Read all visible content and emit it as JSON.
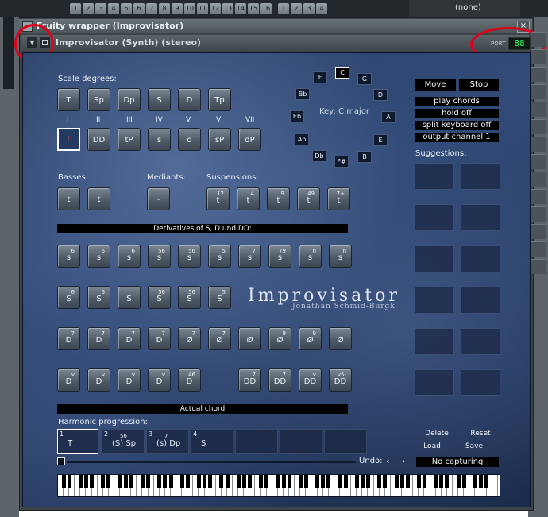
{
  "top_strip": {
    "steps": [
      "1",
      "2",
      "3",
      "4",
      "5",
      "6",
      "7",
      "8",
      "9",
      "10",
      "11",
      "12",
      "13",
      "14",
      "15",
      "16",
      "1",
      "2",
      "3",
      "4"
    ],
    "right_text": "(none)"
  },
  "window": {
    "title": "Fruity wrapper (Improvisator)",
    "close": "×",
    "plugin_title": "Improvisator (Synth) (stereo)",
    "port_label": "PORT",
    "port_value": "88"
  },
  "scale_degrees": {
    "label": "Scale degrees:",
    "row1": [
      "T",
      "Sp",
      "Dp",
      "S",
      "D",
      "Tp"
    ],
    "numerals": [
      "I",
      "II",
      "III",
      "IV",
      "V",
      "VI",
      "VII"
    ],
    "row2": [
      "t",
      "DD",
      "tP",
      "s",
      "d",
      "sP",
      "dP"
    ]
  },
  "circle": {
    "notes": [
      "C",
      "G",
      "D",
      "A",
      "E",
      "B",
      "F#",
      "Db",
      "Ab",
      "Eb",
      "Bb",
      "F"
    ],
    "selected": "C",
    "key_label": "Key: C major"
  },
  "controls": {
    "move": "Move",
    "stop": "Stop",
    "play_chords": "play chords",
    "hold": "hold off",
    "split": "split keyboard off",
    "output": "output channel 1",
    "suggestions": "Suggestions:"
  },
  "basses": {
    "label": "Basses:",
    "buttons": [
      "t",
      "t"
    ]
  },
  "mediants": {
    "label": "Mediants:",
    "buttons": [
      "-"
    ]
  },
  "suspensions": {
    "label": "Suspensions:",
    "buttons": [
      {
        "main": "t",
        "sup": "12"
      },
      {
        "main": "t",
        "sup": "4"
      },
      {
        "main": "t",
        "sup": "9"
      },
      {
        "main": "t",
        "sup": "49"
      },
      {
        "main": "t",
        "sup": "7+"
      }
    ]
  },
  "derivatives": {
    "label": "Derivatives of S, D und DD:",
    "row1": [
      {
        "main": "s",
        "sup": "6"
      },
      {
        "main": "s",
        "sup": "6"
      },
      {
        "main": "s",
        "sup": "6"
      },
      {
        "main": "s",
        "sup": "56"
      },
      {
        "main": "s",
        "sup": "56"
      },
      {
        "main": "s",
        "sup": "5"
      },
      {
        "main": "s",
        "sup": "7"
      },
      {
        "main": "s",
        "sup": "79"
      },
      {
        "main": "s",
        "sup": "n"
      },
      {
        "main": "s",
        "sup": "n"
      }
    ],
    "row2": [
      {
        "main": "S",
        "sup": "6"
      },
      {
        "main": "S",
        "sup": "6"
      },
      {
        "main": "S",
        "sup": ""
      },
      {
        "main": "S",
        "sup": "56"
      },
      {
        "main": "S",
        "sup": "56"
      },
      {
        "main": "S",
        "sup": "5"
      }
    ],
    "row3": [
      {
        "main": "D",
        "sup": "7"
      },
      {
        "main": "D",
        "sup": "7"
      },
      {
        "main": "D",
        "sup": "7"
      },
      {
        "main": "D",
        "sup": "7"
      },
      {
        "main": "Ø",
        "sup": "7"
      },
      {
        "main": "Ø",
        "sup": "7"
      },
      {
        "main": "Ø",
        "sup": ""
      },
      {
        "main": "Ø",
        "sup": "9"
      },
      {
        "main": "Ø",
        "sup": "9"
      },
      {
        "main": "Ø",
        "sup": ""
      }
    ],
    "row4": [
      {
        "main": "D",
        "sup": "v"
      },
      {
        "main": "D",
        "sup": "v"
      },
      {
        "main": "D",
        "sup": "v"
      },
      {
        "main": "D",
        "sup": "v"
      },
      {
        "main": "D",
        "sup": "46"
      },
      {
        "main": "DD",
        "sup": "7"
      },
      {
        "main": "DD",
        "sup": "7"
      },
      {
        "main": "DD",
        "sup": "v"
      },
      {
        "main": "DD",
        "sup": "v5-"
      }
    ]
  },
  "watermark": {
    "title": "Improvisator",
    "author": "Jonathan Schmid-Burgk"
  },
  "actual_chord": {
    "label": "Actual chord"
  },
  "harmonic_progression": {
    "label": "Harmonic progression:",
    "slots": [
      {
        "num": "1",
        "text": "T"
      },
      {
        "num": "2",
        "text": "(S) Sp",
        "sup": "56"
      },
      {
        "num": "3",
        "text": "(s) Dp",
        "sup": "7"
      },
      {
        "num": "4",
        "text": "S"
      },
      {
        "num": "",
        "text": ""
      },
      {
        "num": "",
        "text": ""
      }
    ]
  },
  "buttons_bottom": {
    "delete": "Delete",
    "reset": "Reset",
    "load": "Load",
    "save": "Save"
  },
  "undo": {
    "label": "Undo:",
    "prev": "‹",
    "next": "›"
  },
  "capturing": "No capturing"
}
